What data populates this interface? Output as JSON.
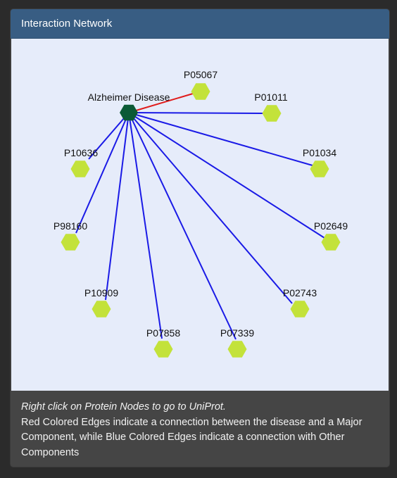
{
  "panel": {
    "title": "Interaction Network"
  },
  "network": {
    "colors": {
      "background": "#e6ecfa",
      "disease_node": "#0b5a36",
      "protein_node": "#c3e23a",
      "major_edge": "#e01b1b",
      "other_edge": "#1a1ae6"
    },
    "disease": {
      "id": "disease",
      "label": "Alzheimer Disease",
      "icon": "hexagon"
    },
    "proteins": [
      {
        "id": "P05067",
        "label": "P05067",
        "edge_type": "major",
        "icon": "hexagon"
      },
      {
        "id": "P01011",
        "label": "P01011",
        "edge_type": "other",
        "icon": "hexagon"
      },
      {
        "id": "P10636",
        "label": "P10636",
        "edge_type": "other",
        "icon": "hexagon"
      },
      {
        "id": "P01034",
        "label": "P01034",
        "edge_type": "other",
        "icon": "hexagon"
      },
      {
        "id": "P98160",
        "label": "P98160",
        "edge_type": "other",
        "icon": "hexagon"
      },
      {
        "id": "P02649",
        "label": "P02649",
        "edge_type": "other",
        "icon": "hexagon"
      },
      {
        "id": "P10909",
        "label": "P10909",
        "edge_type": "other",
        "icon": "hexagon"
      },
      {
        "id": "P02743",
        "label": "P02743",
        "edge_type": "other",
        "icon": "hexagon"
      },
      {
        "id": "P07858",
        "label": "P07858",
        "edge_type": "other",
        "icon": "hexagon"
      },
      {
        "id": "P07339",
        "label": "P07339",
        "edge_type": "other",
        "icon": "hexagon"
      }
    ]
  },
  "footer": {
    "hint": "Right click on Protein Nodes to go to UniProt.",
    "legend": "Red Colored Edges indicate a connection between the disease and a Major Component, while Blue Colored Edges indicate a connection with Other Components"
  }
}
